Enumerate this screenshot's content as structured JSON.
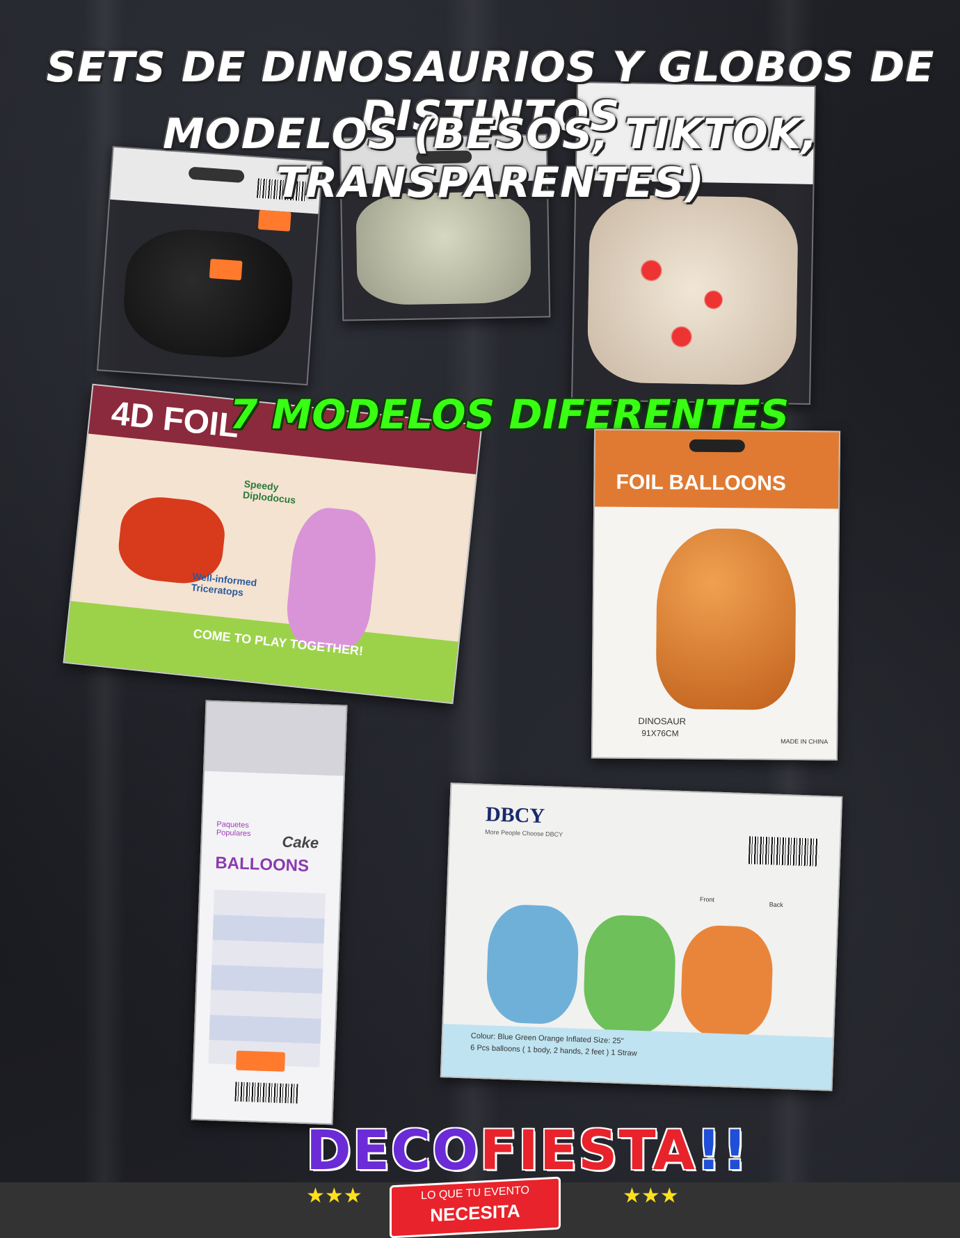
{
  "headline": {
    "line1": "SETS DE DINOSAURIOS Y GLOBOS DE DISTINTOS",
    "line2": "MODELOS (BESOS, TIKTOK, TRANSPARENTES)"
  },
  "subheadline": "7 MODELOS DIFERENTES",
  "packages": {
    "foil_4d": {
      "brand": "4D FOIL",
      "label1": "Speedy Diplodocus",
      "label2": "Well-informed Triceratops",
      "footer": "COME TO PLAY TOGETHER!"
    },
    "foil_balloons": {
      "title": "FOIL BALLOONS",
      "name": "DINOSAUR",
      "size": "91X76CM",
      "origin": "MADE IN CHINA"
    },
    "cake_balloons": {
      "brand": "Paquetes Populares",
      "cake": "Cake",
      "title": "BALLOONS"
    },
    "dbcy": {
      "brand": "DBCY",
      "tagline": "More People Choose DBCY",
      "front": "Front",
      "back": "Back",
      "details": "Colour: Blue  Green  Orange  Inflated Size: 25\"",
      "details2": "6 Pcs balloons ( 1 body, 2 hands, 2 feet )  1 Straw"
    }
  },
  "logo": {
    "word_a": "DECO",
    "word_b": "FIESTA",
    "word_c": "!!",
    "tagline_1": "LO QUE TU EVENTO",
    "tagline_2": "NECESITA",
    "stars": "★★★"
  },
  "colors": {
    "accent_green": "#39ff14",
    "logo_red": "#e8232b",
    "star_yellow": "#ffe020"
  }
}
